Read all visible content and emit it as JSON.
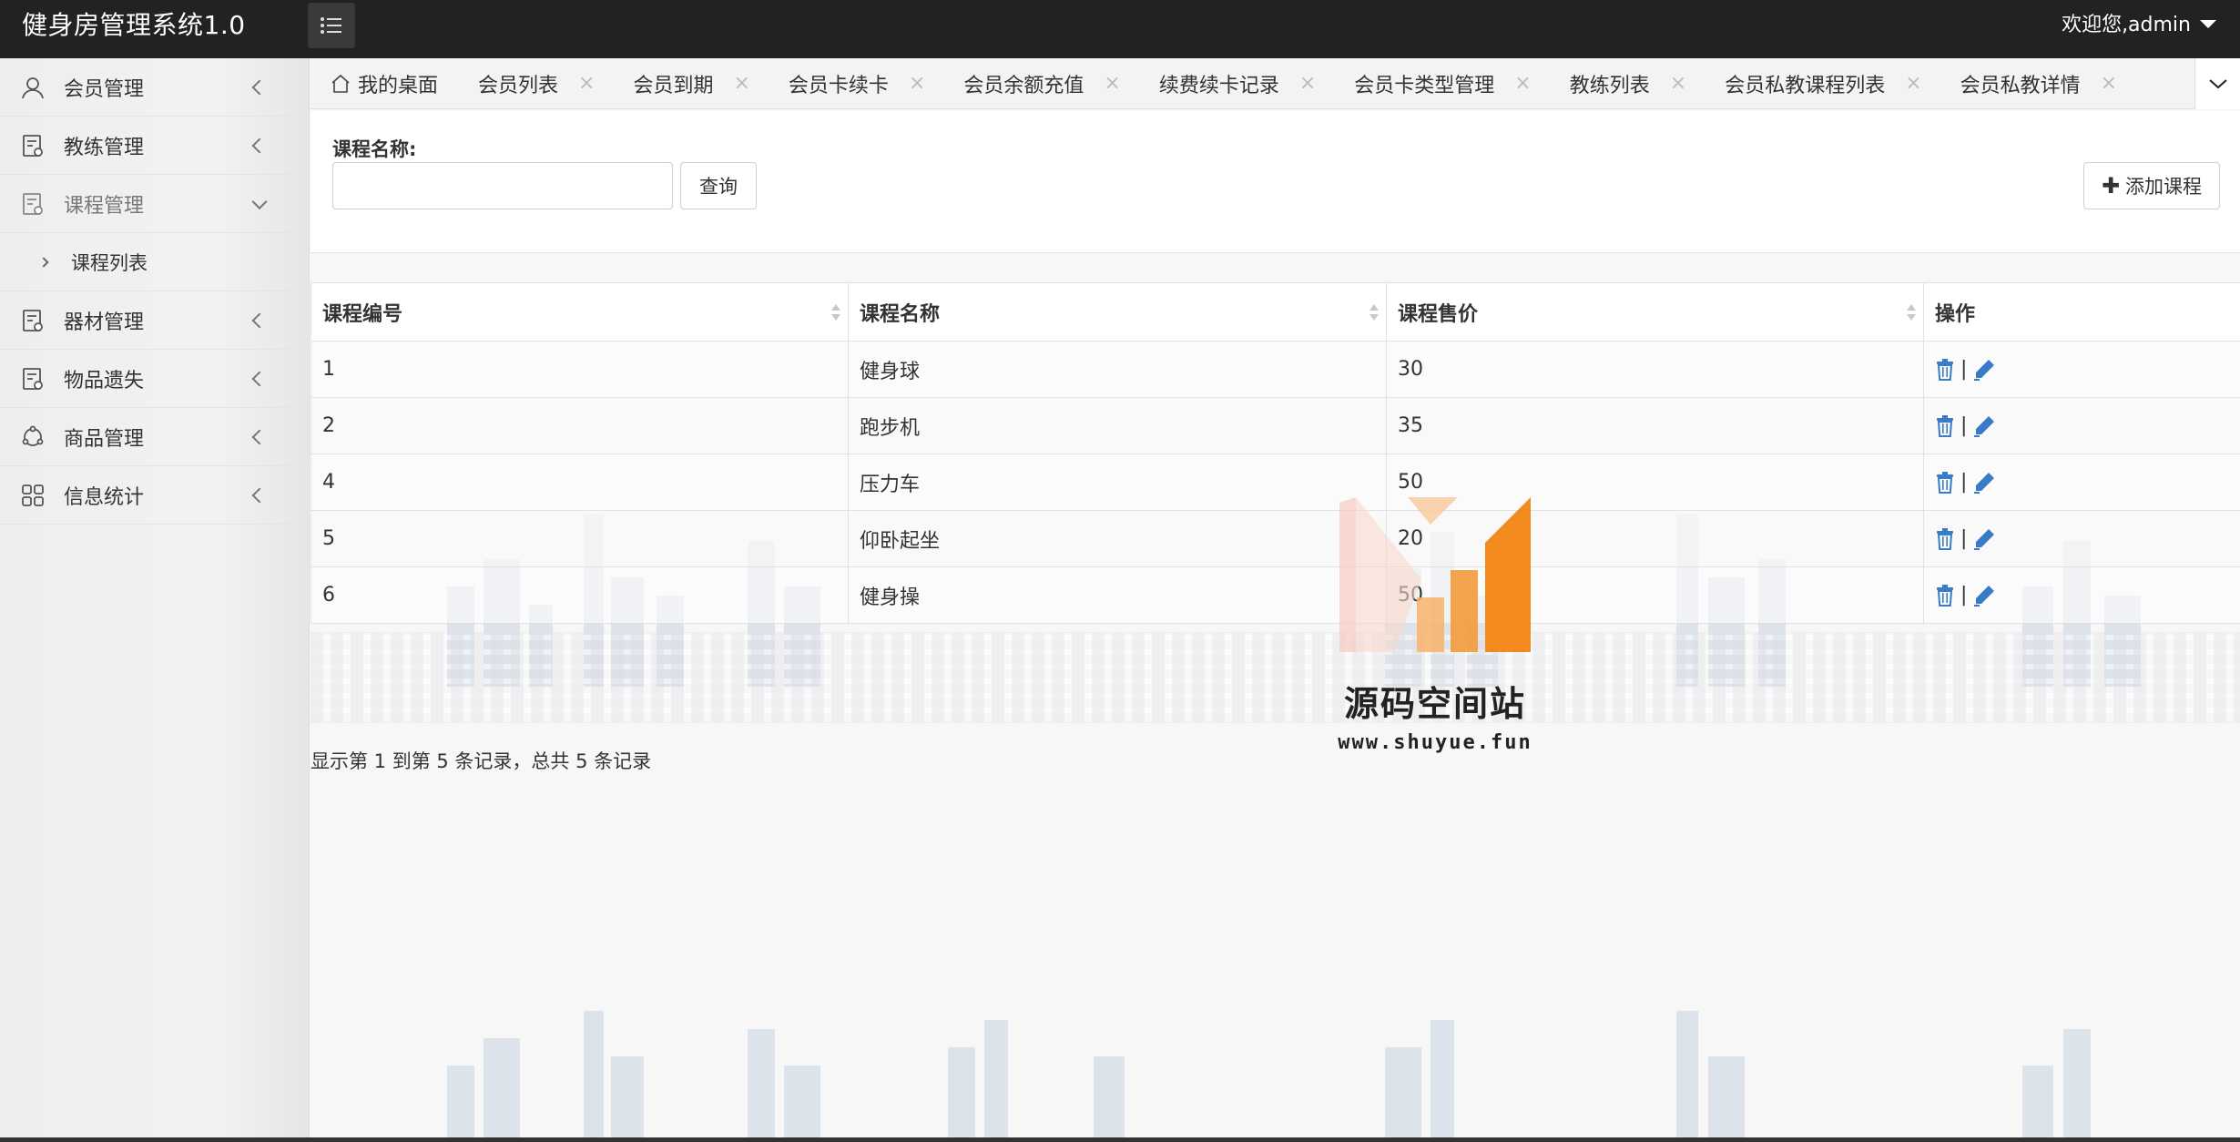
{
  "app": {
    "title": "健身房管理系统1.0",
    "welcome": "欢迎您,admin"
  },
  "sidebar": {
    "items": [
      {
        "label": "会员管理",
        "icon": "user-icon",
        "expanded": false
      },
      {
        "label": "教练管理",
        "icon": "document-icon",
        "expanded": false
      },
      {
        "label": "课程管理",
        "icon": "document-icon",
        "expanded": true
      },
      {
        "label": "器材管理",
        "icon": "document-icon",
        "expanded": false
      },
      {
        "label": "物品遗失",
        "icon": "document-icon",
        "expanded": false
      },
      {
        "label": "商品管理",
        "icon": "cycle-icon",
        "expanded": false
      },
      {
        "label": "信息统计",
        "icon": "grid-icon",
        "expanded": false
      }
    ],
    "sub_items": [
      {
        "label": "课程列表"
      }
    ]
  },
  "tabs": [
    {
      "label": "我的桌面",
      "closable": false
    },
    {
      "label": "会员列表",
      "closable": true
    },
    {
      "label": "会员到期",
      "closable": true
    },
    {
      "label": "会员卡续卡",
      "closable": true
    },
    {
      "label": "会员余额充值",
      "closable": true
    },
    {
      "label": "续费续卡记录",
      "closable": true
    },
    {
      "label": "会员卡类型管理",
      "closable": true
    },
    {
      "label": "教练列表",
      "closable": true
    },
    {
      "label": "会员私教课程列表",
      "closable": true
    },
    {
      "label": "会员私教详情",
      "closable": true
    }
  ],
  "tab_close_glyph": "×",
  "search": {
    "label": "课程名称:",
    "value": "",
    "placeholder": "",
    "query_button": "查询",
    "add_button": "添加课程",
    "add_glyph": "✚"
  },
  "table": {
    "headers": [
      "课程编号",
      "课程名称",
      "课程售价",
      "操作"
    ],
    "rows": [
      {
        "id": "1",
        "name": "健身球",
        "price": "30"
      },
      {
        "id": "2",
        "name": "跑步机",
        "price": "35"
      },
      {
        "id": "4",
        "name": "压力车",
        "price": "50"
      },
      {
        "id": "5",
        "name": "仰卧起坐",
        "price": "20"
      },
      {
        "id": "6",
        "name": "健身操",
        "price": "50"
      }
    ],
    "op_separator": "|"
  },
  "pagination": {
    "info": "显示第 1 到第 5 条记录，总共 5 条记录"
  },
  "watermark": {
    "title": "源码空间站",
    "url": "www.shuyue.fun"
  },
  "colors": {
    "topbar": "#222222",
    "action_icon": "#3a7bc8",
    "logo_orange": "#f28a1e"
  }
}
